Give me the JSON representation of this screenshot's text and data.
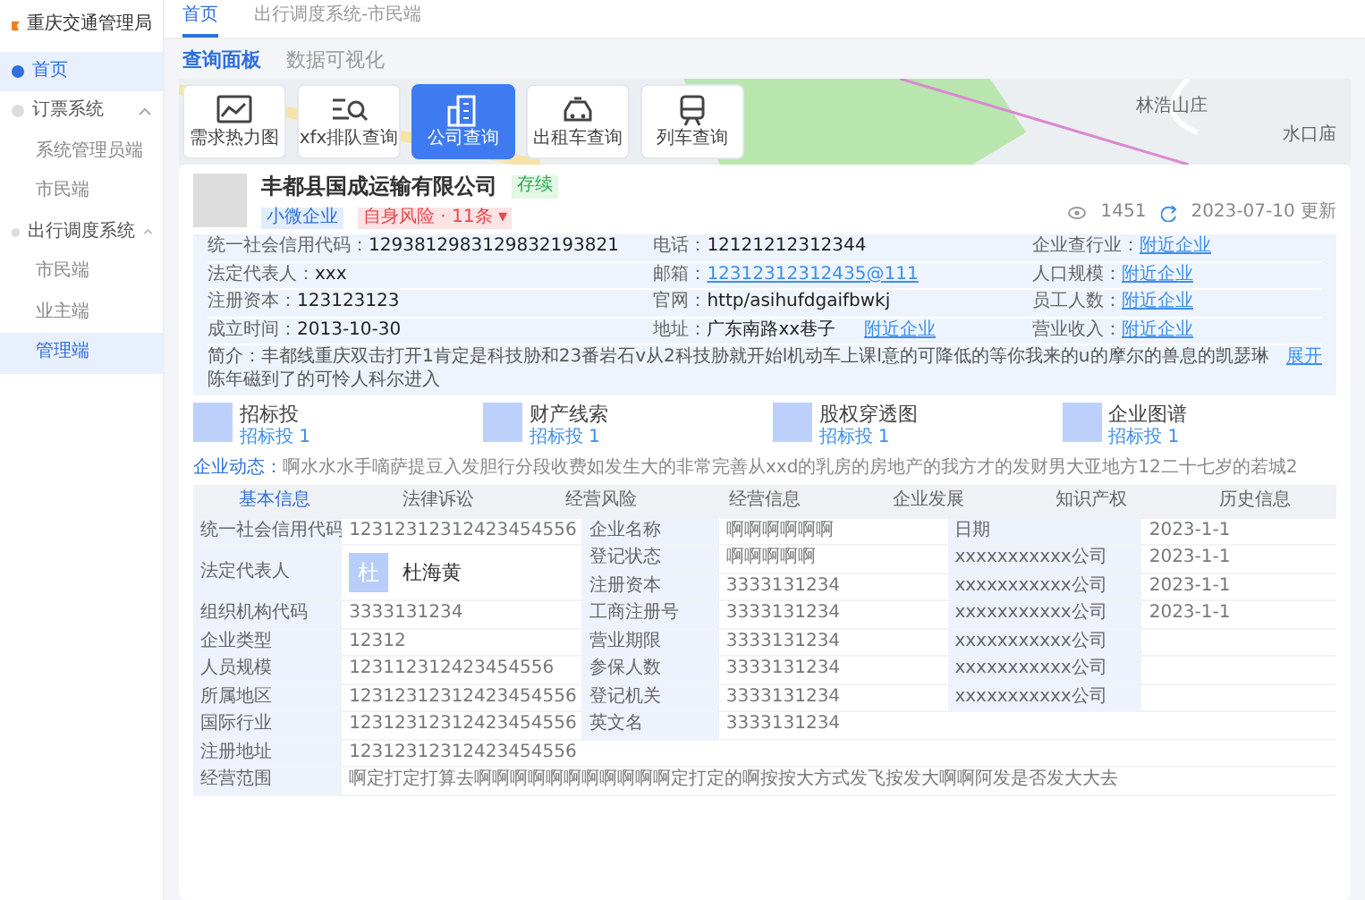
{
  "app": {
    "title": "重庆交通管理局"
  },
  "top_tabs": [
    {
      "label": "首页",
      "selected": true
    },
    {
      "label": "出行调度系统-市民端",
      "selected": false
    }
  ],
  "sidebar": {
    "items": [
      {
        "label": "首页",
        "selected": true
      },
      {
        "label": "订票系统",
        "selected": false,
        "expanded": true,
        "children": [
          {
            "label": "系统管理员端",
            "selected": false
          },
          {
            "label": "市民端",
            "selected": false
          }
        ]
      },
      {
        "label": "出行调度系统",
        "selected": false,
        "expanded": true,
        "children": [
          {
            "label": "市民端",
            "selected": false
          },
          {
            "label": "业主端",
            "selected": false
          },
          {
            "label": "管理端",
            "selected": true
          }
        ]
      }
    ]
  },
  "panel_tabs": [
    {
      "label": "查询面板",
      "selected": true
    },
    {
      "label": "数据可视化",
      "selected": false
    }
  ],
  "map": {
    "places": [
      "林浩山庄",
      "水口庙"
    ]
  },
  "tools": [
    {
      "label": "需求热力图",
      "kind": "heatmap",
      "selected": false
    },
    {
      "label": "xfx排队查询",
      "kind": "search",
      "selected": false
    },
    {
      "label": "公司查询",
      "kind": "building",
      "selected": true
    },
    {
      "label": "出租车查询",
      "kind": "taxi",
      "selected": false
    },
    {
      "label": "列车查询",
      "kind": "train",
      "selected": false
    }
  ],
  "company": {
    "name": "丰都县国成运输有限公司",
    "status": "存续",
    "tags": [
      {
        "label": "小微企业",
        "kind": "info"
      },
      {
        "label": "自身风险 · 11条 ▾",
        "kind": "risk"
      }
    ],
    "views": "1451",
    "updated": "2023-07-10 更新",
    "info": [
      [
        {
          "label": "统一社会信用代码：",
          "value": "1293812983129832193821"
        },
        {
          "label": "电话：",
          "value": "12121212312344"
        },
        {
          "label": "企业查行业：",
          "link": "附近企业"
        }
      ],
      [
        {
          "label": "法定代表人：",
          "value": "xxx"
        },
        {
          "label": "邮箱：",
          "link": "12312312312435@111"
        },
        {
          "label": "人口规模：",
          "link": "附近企业"
        }
      ],
      [
        {
          "label": "注册资本：",
          "value": "123123123"
        },
        {
          "label": "官网：",
          "value": "http/asihufdgaifbwkj"
        },
        {
          "label": "员工人数：",
          "link": "附近企业"
        }
      ],
      [
        {
          "label": "成立时间：",
          "value": "2013-10-30"
        },
        {
          "label": "地址：",
          "value": "广东南路xx巷子",
          "link": "附近企业"
        },
        {
          "label": "营业收入：",
          "link": "附近企业"
        }
      ]
    ],
    "intro": {
      "label": "简介：",
      "text": "丰都线重庆双击打开1肯定是科技胁和23番岩石v从2科技胁就开始l机动车上课l意的可降低的等你我来的u的摩尔的兽息的凯瑟琳陈年磁到了的可怜人科尔进入",
      "more": "展开"
    },
    "features": [
      {
        "title": "招标投",
        "sub": "招标投 1"
      },
      {
        "title": "财产线索",
        "sub": "招标投 1"
      },
      {
        "title": "股权穿透图",
        "sub": "招标投 1"
      },
      {
        "title": "企业图谱",
        "sub": "招标投 1"
      }
    ],
    "news": {
      "label": "企业动态：",
      "text": "啊水水水手嘀萨提豆入发胆行分段收费如发生大的非常完善从xxd的乳房的房地产的我方才的发财男大亚地方12二十七岁的若城2"
    }
  },
  "detail_tabs": [
    {
      "label": "基本信息",
      "selected": true
    },
    {
      "label": "法律诉讼",
      "selected": false
    },
    {
      "label": "经营风险",
      "selected": false
    },
    {
      "label": "经营信息",
      "selected": false
    },
    {
      "label": "企业发展",
      "selected": false
    },
    {
      "label": "知识产权",
      "selected": false
    },
    {
      "label": "历史信息",
      "selected": false
    }
  ],
  "basic_table": {
    "rows": [
      [
        {
          "kind": "label",
          "text": "统一社会信用代码"
        },
        {
          "kind": "value",
          "text": "12312312312423454556"
        },
        {
          "kind": "label",
          "text": "企业名称"
        },
        {
          "kind": "value",
          "text": "啊啊啊啊啊啊"
        },
        {
          "kind": "label",
          "text": "日期"
        },
        {
          "kind": "value",
          "text": "2023-1-1"
        }
      ],
      [
        {
          "kind": "label",
          "text": "法定代表人",
          "rowspan": 2
        },
        {
          "kind": "person",
          "text": "杜海黄",
          "avatar": "杜",
          "rowspan": 2
        },
        {
          "kind": "label",
          "text": "登记状态"
        },
        {
          "kind": "value",
          "text": "啊啊啊啊啊"
        },
        {
          "kind": "label",
          "text": "xxxxxxxxxxx公司"
        },
        {
          "kind": "value",
          "text": "2023-1-1"
        }
      ],
      [
        {
          "kind": "label",
          "text": "注册资本"
        },
        {
          "kind": "value",
          "text": "3333131234"
        },
        {
          "kind": "label",
          "text": "xxxxxxxxxxx公司"
        },
        {
          "kind": "value",
          "text": "2023-1-1"
        }
      ],
      [
        {
          "kind": "label",
          "text": "组织机构代码"
        },
        {
          "kind": "value",
          "text": "3333131234"
        },
        {
          "kind": "label",
          "text": "工商注册号"
        },
        {
          "kind": "value",
          "text": "3333131234"
        },
        {
          "kind": "label",
          "text": "xxxxxxxxxxx公司"
        },
        {
          "kind": "value",
          "text": "2023-1-1"
        }
      ],
      [
        {
          "kind": "label",
          "text": "企业类型"
        },
        {
          "kind": "value",
          "text": "12312"
        },
        {
          "kind": "label",
          "text": "营业期限"
        },
        {
          "kind": "value",
          "text": "3333131234"
        },
        {
          "kind": "label",
          "text": "xxxxxxxxxxx公司"
        }
      ],
      [
        {
          "kind": "label",
          "text": "人员规模"
        },
        {
          "kind": "value",
          "text": "123112312423454556"
        },
        {
          "kind": "label",
          "text": "参保人数"
        },
        {
          "kind": "value",
          "text": "3333131234"
        },
        {
          "kind": "label",
          "text": "xxxxxxxxxxx公司"
        }
      ],
      [
        {
          "kind": "label",
          "text": "所属地区"
        },
        {
          "kind": "value",
          "text": "12312312312423454556"
        },
        {
          "kind": "label",
          "text": "登记机关"
        },
        {
          "kind": "value",
          "text": "3333131234"
        },
        {
          "kind": "label",
          "text": "xxxxxxxxxxx公司"
        }
      ],
      [
        {
          "kind": "label",
          "text": "国际行业"
        },
        {
          "kind": "value",
          "text": "12312312312423454556"
        },
        {
          "kind": "label",
          "text": "英文名"
        },
        {
          "kind": "value",
          "text": "3333131234"
        }
      ],
      [
        {
          "kind": "label",
          "text": "注册地址"
        },
        {
          "kind": "value",
          "text": "12312312312423454556",
          "colspan": 5
        }
      ],
      [
        {
          "kind": "label",
          "text": "经营范围"
        },
        {
          "kind": "value",
          "colspan": 5,
          "text": "啊定打定打算去啊啊啊啊啊啊啊啊啊啊啊定打定的啊按按大方式发飞按发大啊啊阿发是否发大大去"
        }
      ]
    ]
  }
}
